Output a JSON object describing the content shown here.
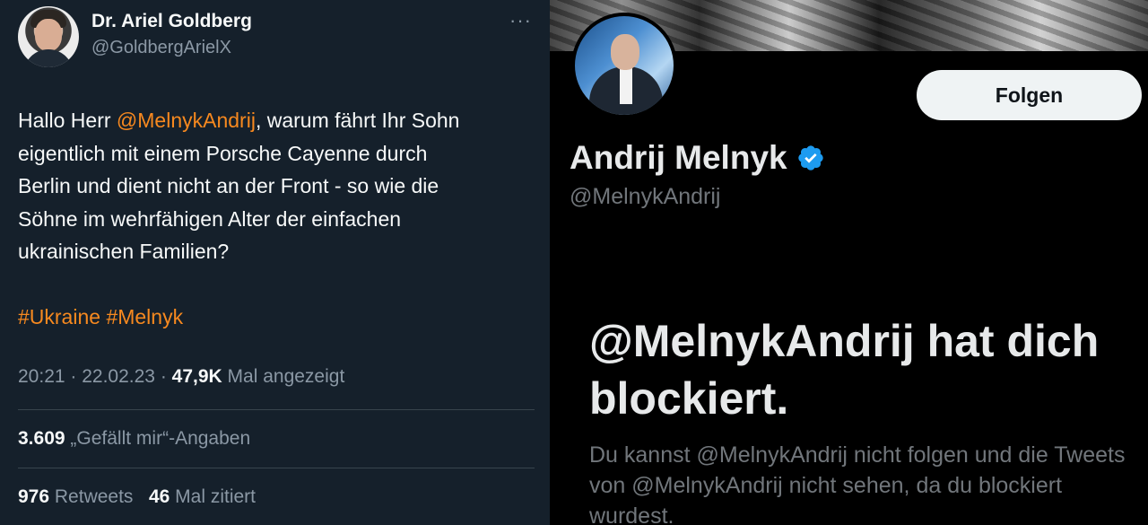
{
  "tweet": {
    "author_name": "Dr. Ariel Goldberg",
    "author_handle": "@GoldbergArielX",
    "more_label": "···",
    "text_before": "Hallo Herr ",
    "mention": "@MelnykAndrij",
    "text_after": ", warum fährt Ihr Sohn\neigentlich mit einem Porsche Cayenne durch\nBerlin und dient nicht an der Front - so wie die\nSöhne im wehrfähigen Alter der einfachen\nukrainischen Familien?",
    "hashtag_1": "#Ukraine",
    "hashtag_2": "#Melnyk",
    "time": "20:21",
    "date": "22.02.23",
    "views_count": "47,9K",
    "views_label": "Mal angezeigt",
    "likes_count": "3.609",
    "likes_label": "„Gefällt mir“-Angaben",
    "retweets_count": "976",
    "retweets_label": "Retweets",
    "quotes_count": "46",
    "quotes_label": "Mal zitiert"
  },
  "profile": {
    "follow_label": "Folgen",
    "name": "Andrij Melnyk",
    "handle": "@MelnykAndrij",
    "blocked_title": "@MelnykAndrij hat dich blockiert.",
    "blocked_desc": "Du kannst @MelnykAndrij nicht folgen und die Tweets von @MelnykAndrij nicht sehen, da du blockiert wurdest."
  },
  "colors": {
    "tweet_bg": "#15202b",
    "accent_orange": "#f7891f",
    "verified_blue": "#1d9bf0"
  },
  "icons": [
    "more-icon",
    "verified-icon"
  ]
}
